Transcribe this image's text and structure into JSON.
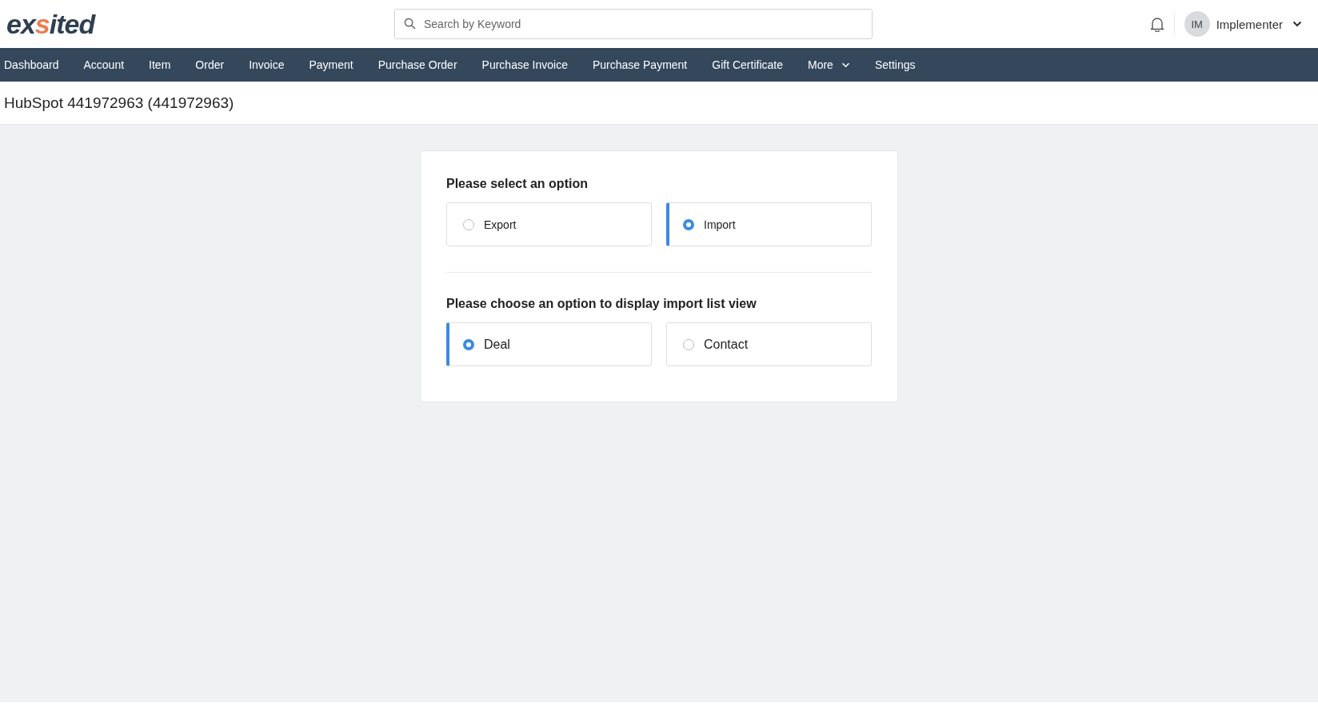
{
  "logo": {
    "before": "ex",
    "accent": "s",
    "after": "ited"
  },
  "search": {
    "placeholder": "Search by Keyword"
  },
  "user": {
    "initials": "IM",
    "name": "Implementer"
  },
  "nav": [
    {
      "label": "Dashboard",
      "kind": "link"
    },
    {
      "label": "Account",
      "kind": "link"
    },
    {
      "label": "Item",
      "kind": "link"
    },
    {
      "label": "Order",
      "kind": "link"
    },
    {
      "label": "Invoice",
      "kind": "link"
    },
    {
      "label": "Payment",
      "kind": "link"
    },
    {
      "label": "Purchase Order",
      "kind": "link"
    },
    {
      "label": "Purchase Invoice",
      "kind": "link"
    },
    {
      "label": "Purchase Payment",
      "kind": "link"
    },
    {
      "label": "Gift Certificate",
      "kind": "link"
    },
    {
      "label": "More",
      "kind": "menu"
    },
    {
      "label": "Settings",
      "kind": "link"
    }
  ],
  "page_title": "HubSpot 441972963 (441972963)",
  "sections": [
    {
      "heading": "Please select an option",
      "large": false,
      "options": [
        {
          "label": "Export",
          "selected": false
        },
        {
          "label": "Import",
          "selected": true
        }
      ]
    },
    {
      "heading": "Please choose an option to display import list view",
      "large": true,
      "options": [
        {
          "label": "Deal",
          "selected": true
        },
        {
          "label": "Contact",
          "selected": false
        }
      ]
    }
  ]
}
